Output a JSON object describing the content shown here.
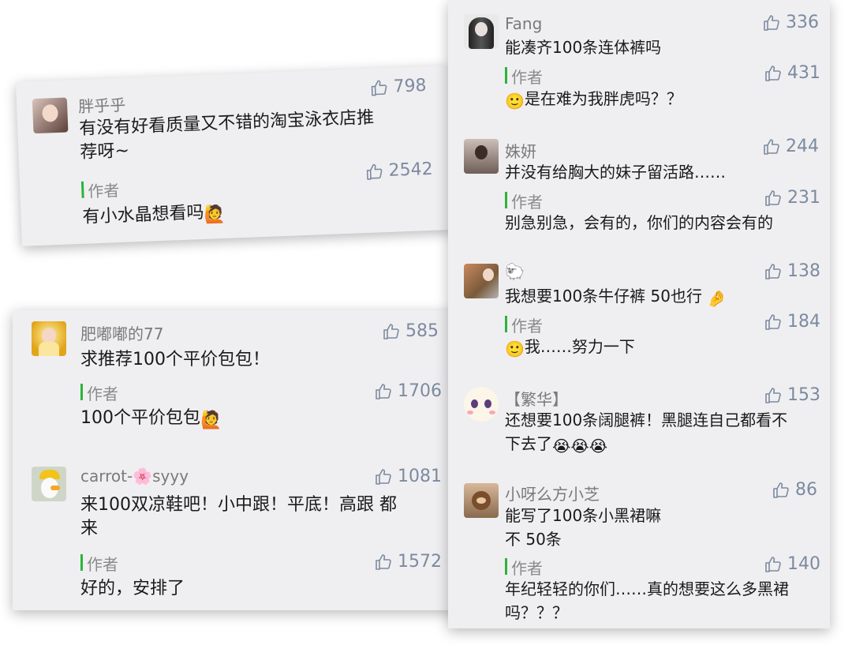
{
  "card1": {
    "comment": {
      "user": "胖乎乎",
      "text_line1": "有没有好看质量又不错的淘宝泳衣店推",
      "text_line2": "荐呀~",
      "likes": "798"
    },
    "reply": {
      "author_label": "作者",
      "text": "有小水晶想看吗",
      "likes": "2542"
    }
  },
  "card2": {
    "comments": [
      {
        "user": "肥嘟嘟的77",
        "text": "求推荐100个平价包包！",
        "likes": "585",
        "reply": {
          "author_label": "作者",
          "text": "100个平价包包",
          "likes": "1706"
        }
      },
      {
        "user_prefix": "carrot-",
        "user_suffix": "syyy",
        "text_line1": "来100双凉鞋吧！小中跟！平底！高跟 都",
        "text_line2": "来",
        "likes": "1081",
        "reply": {
          "author_label": "作者",
          "text": "好的，安排了",
          "likes": "1572"
        }
      }
    ]
  },
  "card3": {
    "comments": [
      {
        "user": "Fang",
        "text": "能凑齐100条连体裤吗",
        "likes": "336",
        "reply": {
          "author_label": "作者",
          "text": "是在难为我胖虎吗？？",
          "likes": "431"
        }
      },
      {
        "user": "姝妍",
        "text": "并没有给胸大的妹子留活路……",
        "likes": "244",
        "reply": {
          "author_label": "作者",
          "text": "别急别急，会有的，你们的内容会有的",
          "likes": "231"
        }
      },
      {
        "user": "🐑",
        "text": "我想要100条牛仔裤 50也行",
        "likes": "138",
        "reply": {
          "author_label": "作者",
          "text": "我……努力一下",
          "likes": "184"
        }
      },
      {
        "user": "【繁华】",
        "text_line1": "还想要100条阔腿裤！黑腿连自己都看不",
        "text_line2": "下去了",
        "likes": "153"
      },
      {
        "user": "小呀么方小芝",
        "text_line1": "能写了100条小黑裙嘛",
        "text_line2": "不 50条",
        "likes": "86",
        "reply": {
          "author_label": "作者",
          "text_line1": "年纪轻轻的你们……真的想要这么多黑裙",
          "text_line2": "吗？？？",
          "likes": "140"
        }
      }
    ]
  },
  "icons": {
    "like": "thumbs-up-icon"
  },
  "colors": {
    "card_bg": "#efeff1",
    "author_bar": "#2db33c",
    "like": "#7d8aa0"
  }
}
